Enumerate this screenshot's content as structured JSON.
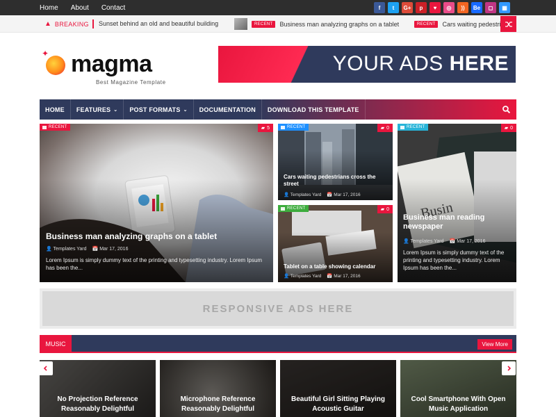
{
  "topbar": {
    "links": [
      "Home",
      "About",
      "Contact"
    ],
    "socials": [
      {
        "icon": "facebook-icon",
        "glyph": "f",
        "color": "#3b5998"
      },
      {
        "icon": "twitter-icon",
        "glyph": "t",
        "color": "#1da1f2"
      },
      {
        "icon": "google-plus-icon",
        "glyph": "G+",
        "color": "#dd4b39"
      },
      {
        "icon": "pinterest-icon",
        "glyph": "p",
        "color": "#cb2027"
      },
      {
        "icon": "heart-icon",
        "glyph": "♥",
        "color": "#e9163e"
      },
      {
        "icon": "dribbble-icon",
        "glyph": "◎",
        "color": "#ea4c89"
      },
      {
        "icon": "rss-icon",
        "glyph": "))",
        "color": "#f26522"
      },
      {
        "icon": "behance-icon",
        "glyph": "Be",
        "color": "#1769ff"
      },
      {
        "icon": "instagram-icon",
        "glyph": "◻",
        "color": "#c13584"
      },
      {
        "icon": "delicious-icon",
        "glyph": "▦",
        "color": "#3399ff"
      }
    ]
  },
  "breaking": {
    "label": "BREAKING",
    "first": "Sunset behind an old and beautiful building",
    "items": [
      {
        "badge": "RECENT",
        "title": "Business man analyzing graphs on a tablet"
      },
      {
        "badge": "RECENT",
        "title": "Cars waiting pedestrians cross the street"
      }
    ]
  },
  "header": {
    "logo": "magma",
    "tagline": "Best Magazine Template",
    "ad": {
      "thin": "YOUR ADS ",
      "bold": "HERE"
    }
  },
  "nav": {
    "items": [
      {
        "label": "HOME",
        "dropdown": false
      },
      {
        "label": "FEATURES",
        "dropdown": true
      },
      {
        "label": "POST FORMATS",
        "dropdown": true
      },
      {
        "label": "DOCUMENTATION",
        "dropdown": false
      },
      {
        "label": "DOWNLOAD THIS TEMPLATE",
        "dropdown": false
      }
    ],
    "chevron": "⌄"
  },
  "hero": {
    "main": {
      "category": "RECENT",
      "comments": "5",
      "title": "Business man analyzing graphs on a tablet",
      "author": "Templates Yard",
      "date": "Mar 17, 2016",
      "excerpt": "Lorem Ipsum is simply dummy text of the printing and typesetting industry. Lorem Ipsum has been the..."
    },
    "mid_top": {
      "category": "RECENT",
      "comments": "0",
      "title": "Cars waiting pedestrians cross the street",
      "author": "Templates Yard",
      "date": "Mar 17, 2016"
    },
    "mid_bottom": {
      "category": "RECENT",
      "comments": "0",
      "title": "Tablet on a table showing calendar",
      "author": "Templates Yard",
      "date": "Mar 17, 2016"
    },
    "right": {
      "category": "RECENT",
      "comments": "0",
      "title": "Business man reading newspaper",
      "author": "Templates Yard",
      "date": "Mar 17, 2016",
      "excerpt": "Lorem Ipsum is simply dummy text of the printing and typesetting industry. Lorem Ipsum has been the..."
    }
  },
  "responsive_ad": "RESPONSIVE ADS HERE",
  "music": {
    "label": "MUSIC",
    "view_more": "View More",
    "cards": [
      "No Projection Reference Reasonably Delightful",
      "Microphone Reference Reasonably Delightful",
      "Beautiful Girl Sitting Playing Acoustic Guitar",
      "Cool Smartphone With Open Music Application"
    ]
  },
  "colors": {
    "accent": "#e9163e",
    "navy": "#2f3a5c",
    "badge_blue": "#1e90ff",
    "badge_green": "#3dac3d",
    "badge_pink": "#e9163e",
    "badge_cyan": "#28b4d8"
  }
}
